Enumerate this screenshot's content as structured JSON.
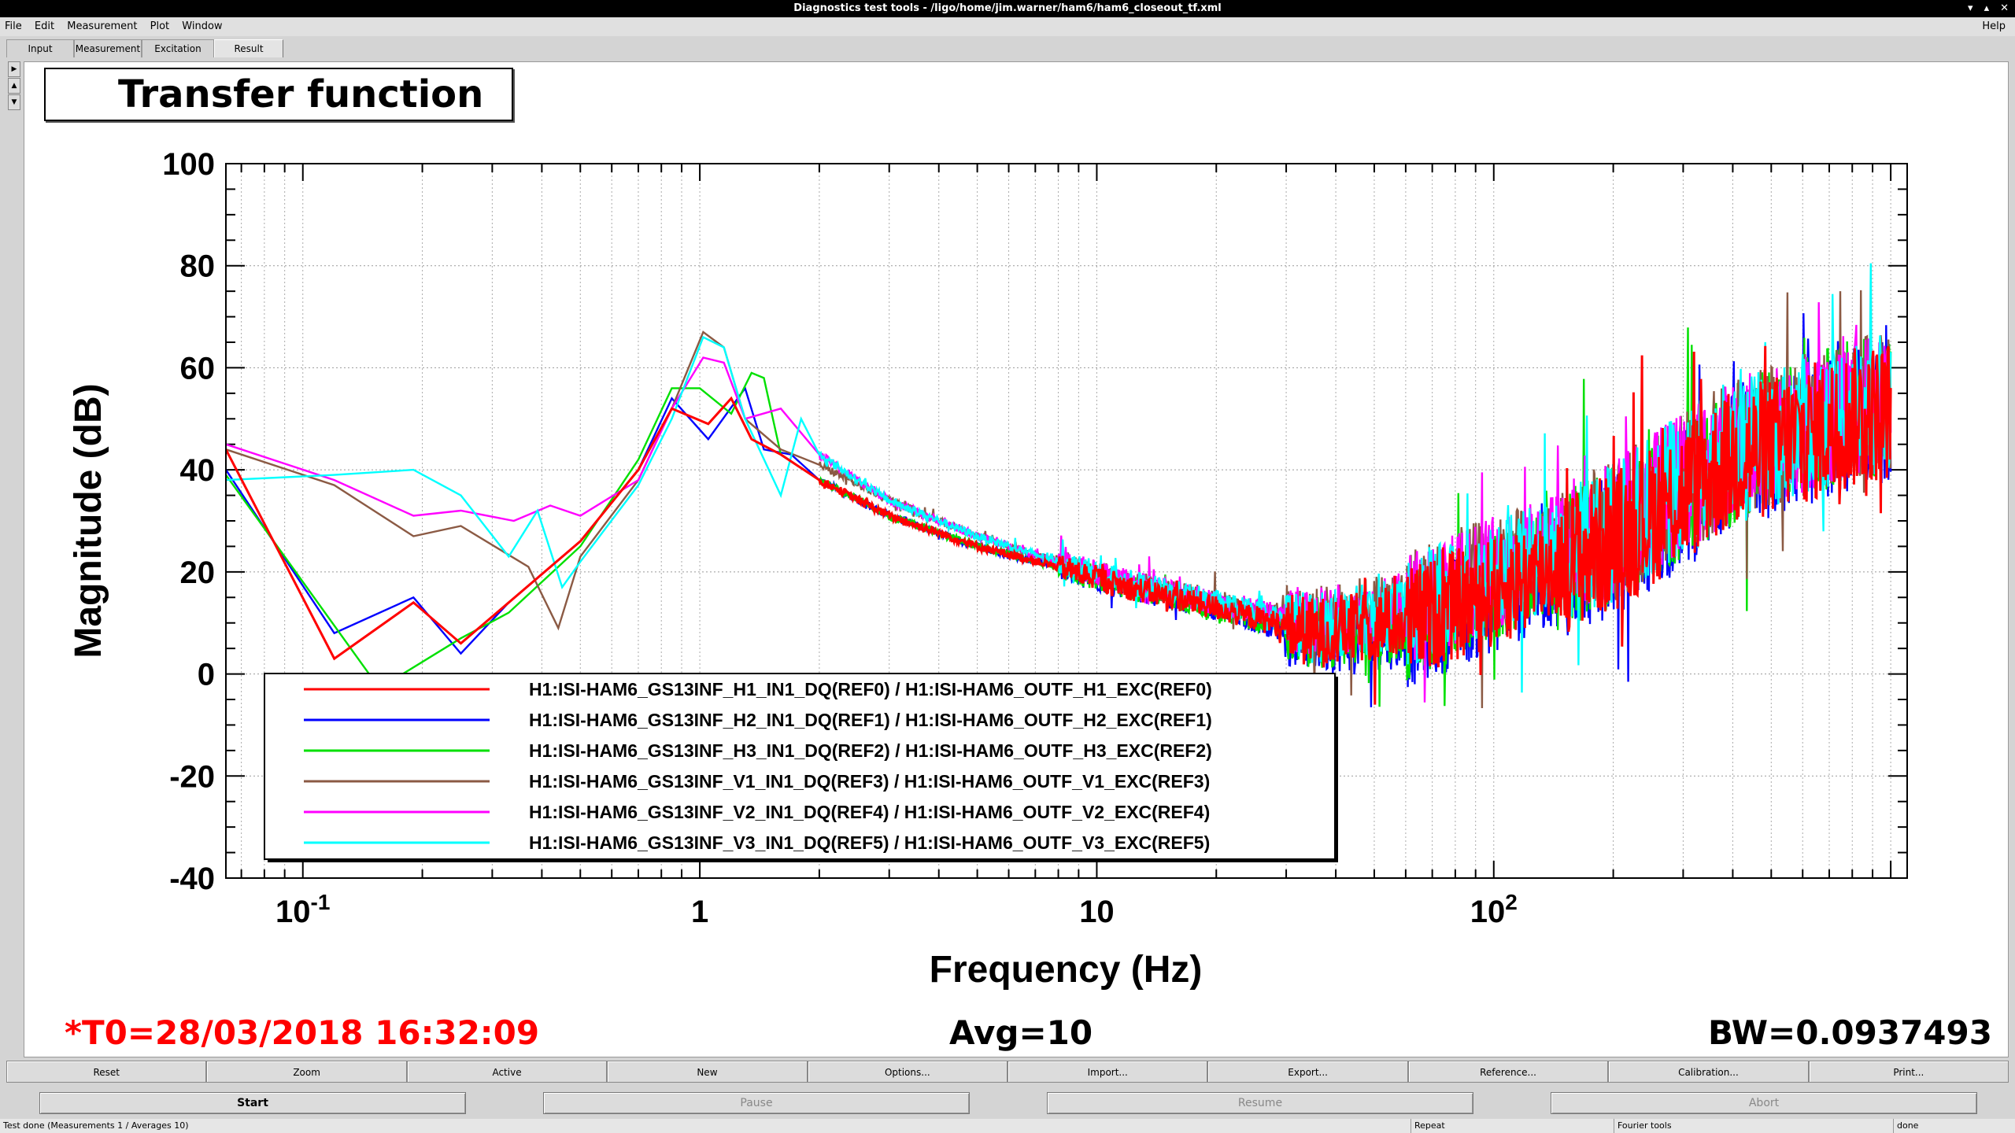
{
  "window": {
    "title": "Diagnostics test tools - /ligo/home/jim.warner/ham6/ham6_closeout_tf.xml"
  },
  "menu": {
    "items": [
      "File",
      "Edit",
      "Measurement",
      "Plot",
      "Window"
    ],
    "help": "Help"
  },
  "tabs": [
    "Input",
    "Measurement",
    "Excitation",
    "Result"
  ],
  "active_tab": "Result",
  "plot": {
    "title": "Transfer function",
    "t0": "*T0=28/03/2018 16:32:09",
    "avg": "Avg=10",
    "bw": "BW=0.0937493",
    "colors": {
      "t0": "#ff0000"
    }
  },
  "chart_data": {
    "type": "line",
    "title": "Transfer function",
    "xlabel": "Frequency (Hz)",
    "ylabel": "Magnitude (dB)",
    "x_scale": "log",
    "xlim": [
      0.064,
      1100
    ],
    "ylim": [
      -40,
      100
    ],
    "x_ticks": [
      {
        "value": 0.1,
        "base": "10",
        "exp": "-1"
      },
      {
        "value": 1,
        "base": "1",
        "exp": ""
      },
      {
        "value": 10,
        "base": "10",
        "exp": ""
      },
      {
        "value": 100,
        "base": "10",
        "exp": "2"
      }
    ],
    "y_ticks": [
      -40,
      -20,
      0,
      20,
      40,
      60,
      80,
      100
    ],
    "grid": true,
    "legend_position": "lower-left",
    "series": [
      {
        "name": "H1:ISI-HAM6_GS13INF_H1_IN1_DQ(REF0) / H1:ISI-HAM6_OUTF_H1_EXC(REF0)",
        "color": "#ff0000",
        "points": [
          [
            0.064,
            44
          ],
          [
            0.12,
            3
          ],
          [
            0.19,
            14
          ],
          [
            0.25,
            6
          ],
          [
            0.33,
            14
          ],
          [
            0.5,
            26
          ],
          [
            0.7,
            40
          ],
          [
            0.85,
            52
          ],
          [
            1.05,
            49
          ],
          [
            1.2,
            54
          ],
          [
            1.35,
            46
          ],
          [
            1.6,
            43
          ],
          [
            2,
            38
          ],
          [
            3,
            31
          ],
          [
            5,
            25
          ],
          [
            8,
            21
          ],
          [
            12,
            17
          ],
          [
            20,
            13
          ],
          [
            35,
            8
          ],
          [
            60,
            10
          ],
          [
            100,
            16
          ],
          [
            200,
            26
          ],
          [
            400,
            42
          ],
          [
            800,
            50
          ],
          [
            1000,
            52
          ]
        ]
      },
      {
        "name": "H1:ISI-HAM6_GS13INF_H2_IN1_DQ(REF1) / H1:ISI-HAM6_OUTF_H2_EXC(REF1)",
        "color": "#0000ff",
        "points": [
          [
            0.064,
            40
          ],
          [
            0.12,
            8
          ],
          [
            0.19,
            15
          ],
          [
            0.25,
            4
          ],
          [
            0.33,
            14
          ],
          [
            0.5,
            26
          ],
          [
            0.7,
            40
          ],
          [
            0.85,
            54
          ],
          [
            1.05,
            46
          ],
          [
            1.3,
            56
          ],
          [
            1.45,
            44
          ],
          [
            1.7,
            43
          ],
          [
            2,
            38
          ],
          [
            3,
            31
          ],
          [
            5,
            25
          ],
          [
            8,
            21
          ],
          [
            12,
            17
          ],
          [
            20,
            13
          ],
          [
            35,
            7
          ],
          [
            60,
            8
          ],
          [
            100,
            15
          ],
          [
            200,
            25
          ],
          [
            400,
            41
          ],
          [
            800,
            50
          ],
          [
            1000,
            52
          ]
        ]
      },
      {
        "name": "H1:ISI-HAM6_GS13INF_H3_IN1_DQ(REF2) / H1:ISI-HAM6_OUTF_H3_EXC(REF2)",
        "color": "#00e000",
        "points": [
          [
            0.064,
            39
          ],
          [
            0.15,
            -1
          ],
          [
            0.17,
            -1
          ],
          [
            0.25,
            7
          ],
          [
            0.33,
            12
          ],
          [
            0.5,
            25
          ],
          [
            0.7,
            42
          ],
          [
            0.85,
            56
          ],
          [
            1,
            56
          ],
          [
            1.2,
            51
          ],
          [
            1.35,
            59
          ],
          [
            1.45,
            58
          ],
          [
            1.6,
            43
          ],
          [
            2,
            38
          ],
          [
            3,
            31
          ],
          [
            5,
            25
          ],
          [
            8,
            21
          ],
          [
            12,
            17
          ],
          [
            20,
            13
          ],
          [
            35,
            8
          ],
          [
            60,
            9
          ],
          [
            100,
            17
          ],
          [
            200,
            27
          ],
          [
            400,
            43
          ],
          [
            800,
            52
          ],
          [
            1000,
            53
          ]
        ]
      },
      {
        "name": "H1:ISI-HAM6_GS13INF_V1_IN1_DQ(REF3) / H1:ISI-HAM6_OUTF_V1_EXC(REF3)",
        "color": "#8b5a44",
        "points": [
          [
            0.064,
            44
          ],
          [
            0.12,
            37
          ],
          [
            0.19,
            27
          ],
          [
            0.25,
            29
          ],
          [
            0.37,
            21
          ],
          [
            0.44,
            9
          ],
          [
            0.5,
            23
          ],
          [
            0.7,
            38
          ],
          [
            0.85,
            52
          ],
          [
            1.02,
            67
          ],
          [
            1.15,
            64
          ],
          [
            1.3,
            50
          ],
          [
            1.6,
            44
          ],
          [
            2,
            41
          ],
          [
            3,
            34
          ],
          [
            5,
            27
          ],
          [
            8,
            22
          ],
          [
            12,
            18
          ],
          [
            20,
            14
          ],
          [
            35,
            10
          ],
          [
            60,
            14
          ],
          [
            100,
            20
          ],
          [
            200,
            28
          ],
          [
            400,
            44
          ],
          [
            800,
            52
          ],
          [
            1000,
            53
          ]
        ]
      },
      {
        "name": "H1:ISI-HAM6_GS13INF_V2_IN1_DQ(REF4) / H1:ISI-HAM6_OUTF_V2_EXC(REF4)",
        "color": "#ff00ff",
        "points": [
          [
            0.064,
            45
          ],
          [
            0.12,
            38
          ],
          [
            0.19,
            31
          ],
          [
            0.25,
            32
          ],
          [
            0.34,
            30
          ],
          [
            0.42,
            33
          ],
          [
            0.5,
            31
          ],
          [
            0.7,
            38
          ],
          [
            0.85,
            52
          ],
          [
            1.02,
            62
          ],
          [
            1.15,
            61
          ],
          [
            1.3,
            50
          ],
          [
            1.6,
            52
          ],
          [
            2,
            43
          ],
          [
            3,
            34
          ],
          [
            5,
            27
          ],
          [
            8,
            22
          ],
          [
            12,
            18
          ],
          [
            20,
            14
          ],
          [
            35,
            10
          ],
          [
            60,
            13
          ],
          [
            100,
            20
          ],
          [
            200,
            29
          ],
          [
            400,
            44
          ],
          [
            800,
            53
          ],
          [
            1000,
            54
          ]
        ]
      },
      {
        "name": "H1:ISI-HAM6_GS13INF_V3_IN1_DQ(REF5) / H1:ISI-HAM6_OUTF_V3_EXC(REF5)",
        "color": "#00ffff",
        "points": [
          [
            0.064,
            38
          ],
          [
            0.12,
            39
          ],
          [
            0.19,
            40
          ],
          [
            0.25,
            35
          ],
          [
            0.33,
            23
          ],
          [
            0.39,
            32
          ],
          [
            0.45,
            17
          ],
          [
            0.5,
            22
          ],
          [
            0.7,
            37
          ],
          [
            0.85,
            50
          ],
          [
            1.02,
            66
          ],
          [
            1.15,
            64
          ],
          [
            1.3,
            50
          ],
          [
            1.6,
            35
          ],
          [
            1.8,
            50
          ],
          [
            2,
            43
          ],
          [
            3,
            34
          ],
          [
            5,
            27
          ],
          [
            8,
            22
          ],
          [
            12,
            18
          ],
          [
            20,
            14
          ],
          [
            35,
            9
          ],
          [
            60,
            12
          ],
          [
            100,
            19
          ],
          [
            200,
            28
          ],
          [
            400,
            44
          ],
          [
            800,
            52
          ],
          [
            1000,
            53
          ]
        ]
      }
    ]
  },
  "buttons_row1": [
    "Reset",
    "Zoom",
    "Active",
    "New",
    "Options...",
    "Import...",
    "Export...",
    "Reference...",
    "Calibration...",
    "Print..."
  ],
  "buttons_row2": [
    "Start",
    "Pause",
    "Resume",
    "Abort"
  ],
  "status": {
    "message": "Test done (Measurements 1 / Averages 10)",
    "mode": "Repeat",
    "tool": "Fourier tools",
    "state": "done"
  }
}
